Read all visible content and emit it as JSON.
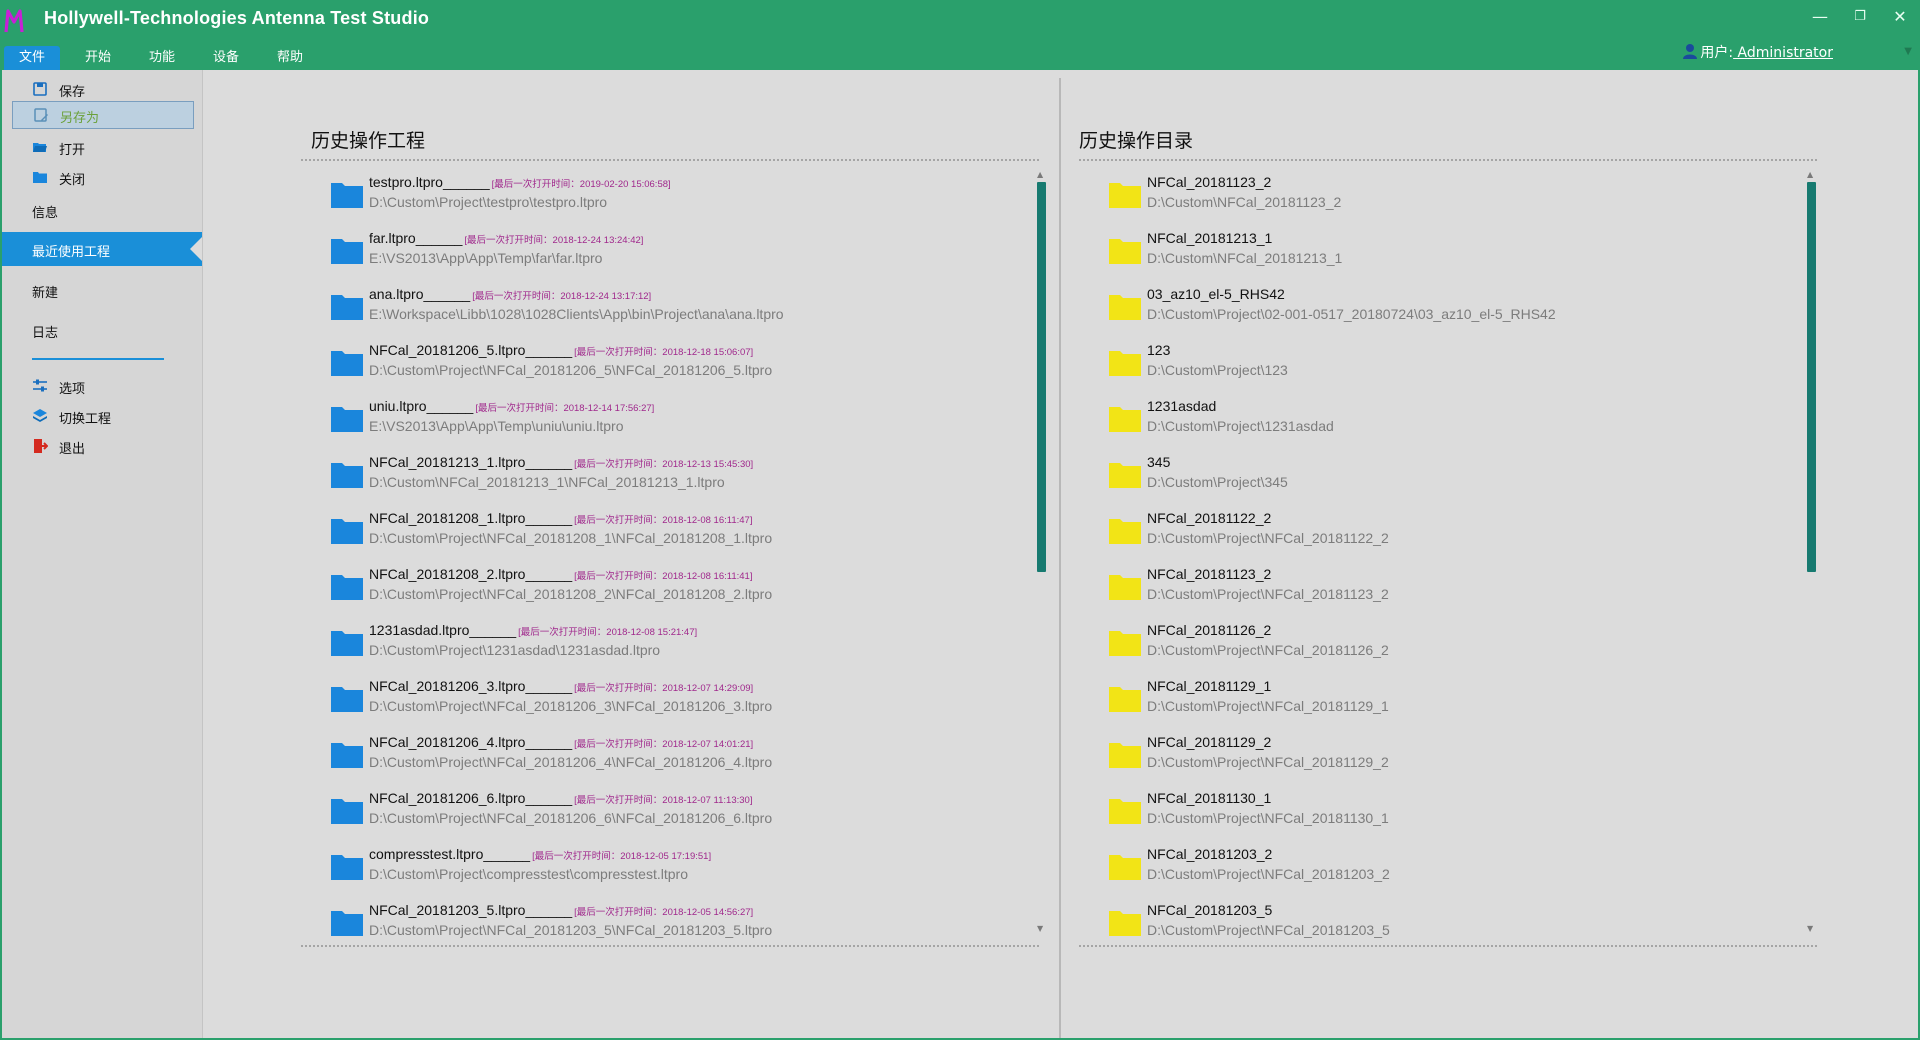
{
  "app": {
    "title": "Hollywell-Technologies Antenna Test Studio",
    "logo_icon": "app-logo-m",
    "accent": "#2aa06c",
    "menu_active_color": "#1a8fd8"
  },
  "window_controls": {
    "minimize": "—",
    "restore": "❐",
    "close": "✕"
  },
  "menu": [
    {
      "label": "文件",
      "active": true
    },
    {
      "label": "开始"
    },
    {
      "label": "功能"
    },
    {
      "label": "设备"
    },
    {
      "label": "帮助"
    }
  ],
  "user": {
    "prefix": "用户:",
    "name": " Administrator",
    "icon": "user-icon"
  },
  "sidebar": {
    "save": {
      "label": "保存",
      "icon": "save-icon"
    },
    "save_as": {
      "label": "另存为",
      "icon": "save-as-icon"
    },
    "open": {
      "label": "打开",
      "icon": "open-folder-icon"
    },
    "close": {
      "label": "关闭",
      "icon": "folder-close-icon"
    },
    "info": "信息",
    "recent": "最近使用工程",
    "new": "新建",
    "log": "日志",
    "options": {
      "label": "选项",
      "icon": "sliders-icon"
    },
    "switch_project": {
      "label": "切换工程",
      "icon": "layers-icon"
    },
    "exit": {
      "label": "退出",
      "icon": "exit-icon"
    }
  },
  "left_panel": {
    "title": "历史操作工程",
    "folder_color": "#1a86dc",
    "items": [
      {
        "name": "testpro.ltpro",
        "time": "[最后一次打开时间：2019-02-20 15:06:58]",
        "path": "D:\\Custom\\Project\\testpro\\testpro.ltpro"
      },
      {
        "name": "far.ltpro",
        "time": "[最后一次打开时间：2018-12-24 13:24:42]",
        "path": "E:\\VS2013\\App\\App\\Temp\\far\\far.ltpro"
      },
      {
        "name": "ana.ltpro",
        "time": "[最后一次打开时间：2018-12-24 13:17:12]",
        "path": "E:\\Workspace\\Libb\\1028\\1028Clients\\App\\bin\\Project\\ana\\ana.ltpro"
      },
      {
        "name": "NFCal_20181206_5.ltpro",
        "time": "[最后一次打开时间：2018-12-18 15:06:07]",
        "path": "D:\\Custom\\Project\\NFCal_20181206_5\\NFCal_20181206_5.ltpro"
      },
      {
        "name": "uniu.ltpro",
        "time": "[最后一次打开时间：2018-12-14 17:56:27]",
        "path": "E:\\VS2013\\App\\App\\Temp\\uniu\\uniu.ltpro"
      },
      {
        "name": "NFCal_20181213_1.ltpro",
        "time": "[最后一次打开时间：2018-12-13 15:45:30]",
        "path": "D:\\Custom\\NFCal_20181213_1\\NFCal_20181213_1.ltpro"
      },
      {
        "name": "NFCal_20181208_1.ltpro",
        "time": "[最后一次打开时间：2018-12-08 16:11:47]",
        "path": "D:\\Custom\\Project\\NFCal_20181208_1\\NFCal_20181208_1.ltpro"
      },
      {
        "name": "NFCal_20181208_2.ltpro",
        "time": "[最后一次打开时间：2018-12-08 16:11:41]",
        "path": "D:\\Custom\\Project\\NFCal_20181208_2\\NFCal_20181208_2.ltpro"
      },
      {
        "name": "1231asdad.ltpro",
        "time": "[最后一次打开时间：2018-12-08 15:21:47]",
        "path": "D:\\Custom\\Project\\1231asdad\\1231asdad.ltpro"
      },
      {
        "name": "NFCal_20181206_3.ltpro",
        "time": "[最后一次打开时间：2018-12-07 14:29:09]",
        "path": "D:\\Custom\\Project\\NFCal_20181206_3\\NFCal_20181206_3.ltpro"
      },
      {
        "name": "NFCal_20181206_4.ltpro",
        "time": "[最后一次打开时间：2018-12-07 14:01:21]",
        "path": "D:\\Custom\\Project\\NFCal_20181206_4\\NFCal_20181206_4.ltpro"
      },
      {
        "name": "NFCal_20181206_6.ltpro",
        "time": "[最后一次打开时间：2018-12-07 11:13:30]",
        "path": "D:\\Custom\\Project\\NFCal_20181206_6\\NFCal_20181206_6.ltpro"
      },
      {
        "name": "compresstest.ltpro",
        "time": "[最后一次打开时间：2018-12-05 17:19:51]",
        "path": "D:\\Custom\\Project\\compresstest\\compresstest.ltpro"
      },
      {
        "name": "NFCal_20181203_5.ltpro",
        "time": "[最后一次打开时间：2018-12-05 14:56:27]",
        "path": "D:\\Custom\\Project\\NFCal_20181203_5\\NFCal_20181203_5.ltpro"
      }
    ]
  },
  "right_panel": {
    "title": "历史操作目录",
    "folder_color": "#f2e416",
    "items": [
      {
        "name": "NFCal_20181123_2",
        "path": "D:\\Custom\\NFCal_20181123_2"
      },
      {
        "name": "NFCal_20181213_1",
        "path": "D:\\Custom\\NFCal_20181213_1"
      },
      {
        "name": "03_az10_el-5_RHS42",
        "path": "D:\\Custom\\Project\\02-001-0517_20180724\\03_az10_el-5_RHS42"
      },
      {
        "name": "123",
        "path": "D:\\Custom\\Project\\123"
      },
      {
        "name": "1231asdad",
        "path": "D:\\Custom\\Project\\1231asdad"
      },
      {
        "name": "345",
        "path": "D:\\Custom\\Project\\345"
      },
      {
        "name": "NFCal_20181122_2",
        "path": "D:\\Custom\\Project\\NFCal_20181122_2"
      },
      {
        "name": "NFCal_20181123_2",
        "path": "D:\\Custom\\Project\\NFCal_20181123_2"
      },
      {
        "name": "NFCal_20181126_2",
        "path": "D:\\Custom\\Project\\NFCal_20181126_2"
      },
      {
        "name": "NFCal_20181129_1",
        "path": "D:\\Custom\\Project\\NFCal_20181129_1"
      },
      {
        "name": "NFCal_20181129_2",
        "path": "D:\\Custom\\Project\\NFCal_20181129_2"
      },
      {
        "name": "NFCal_20181130_1",
        "path": "D:\\Custom\\Project\\NFCal_20181130_1"
      },
      {
        "name": "NFCal_20181203_2",
        "path": "D:\\Custom\\Project\\NFCal_20181203_2"
      },
      {
        "name": "NFCal_20181203_5",
        "path": "D:\\Custom\\Project\\NFCal_20181203_5"
      }
    ]
  }
}
